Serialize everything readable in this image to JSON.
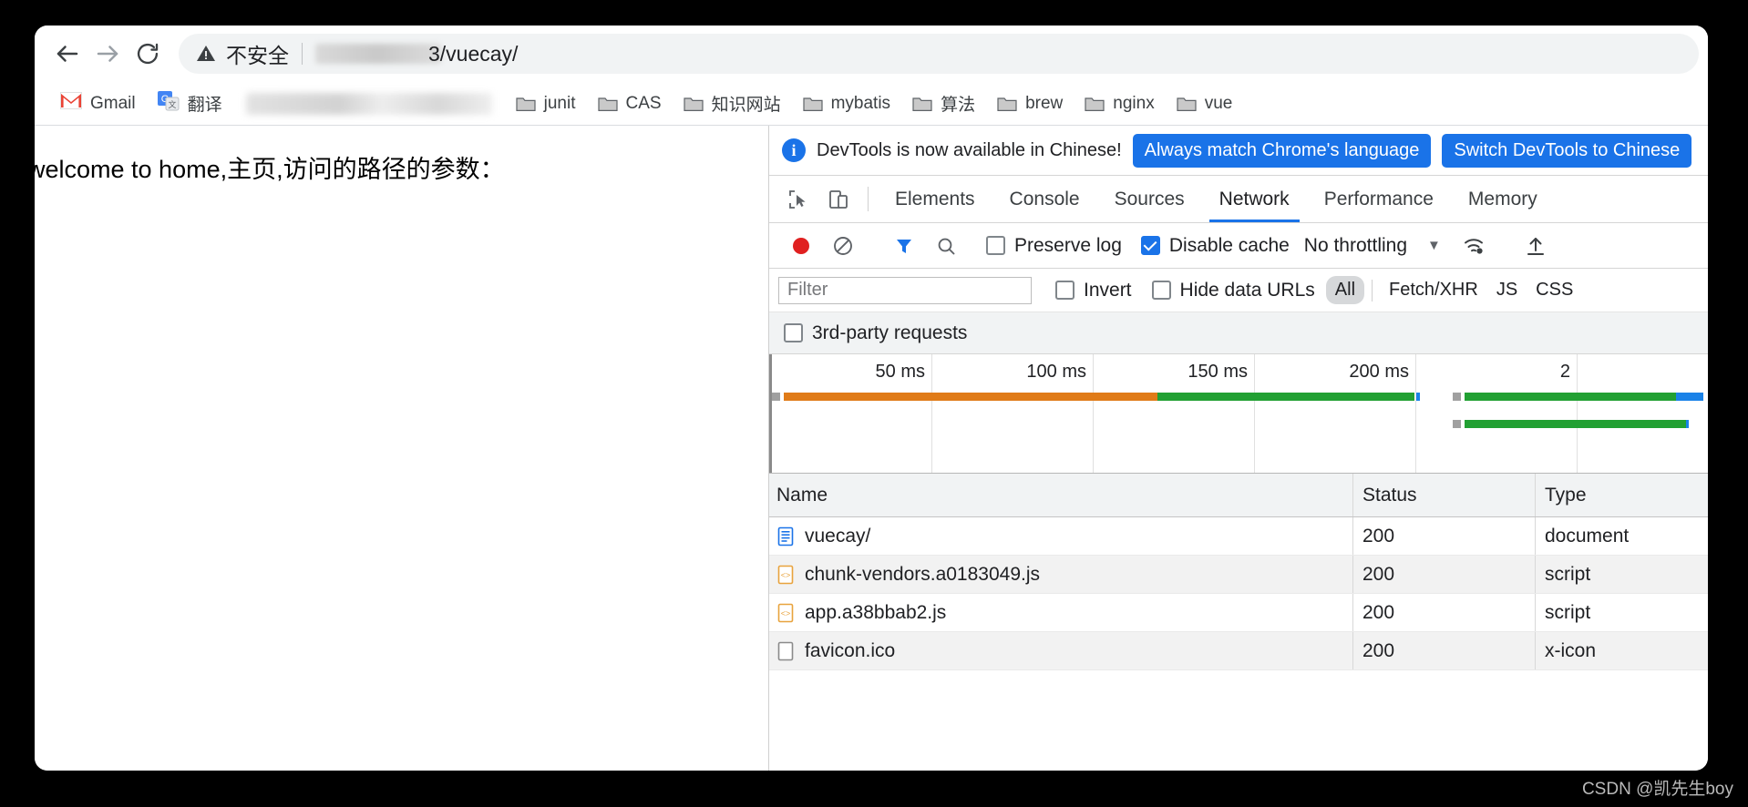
{
  "browser": {
    "back_label": "back-arrow",
    "forward_label": "forward-arrow",
    "reload_label": "reload",
    "security_text": "不安全",
    "url_text": "3/vuecay/",
    "bookmarks": [
      {
        "label": "Gmail",
        "icon": "gmail-icon"
      },
      {
        "label": "翻译",
        "icon": "google-translate-icon"
      },
      {
        "label": "",
        "icon": "redacted"
      },
      {
        "label": "junit",
        "icon": "folder-icon"
      },
      {
        "label": "CAS",
        "icon": "folder-icon"
      },
      {
        "label": "知识网站",
        "icon": "folder-icon"
      },
      {
        "label": "mybatis",
        "icon": "folder-icon"
      },
      {
        "label": "算法",
        "icon": "folder-icon"
      },
      {
        "label": "brew",
        "icon": "folder-icon"
      },
      {
        "label": "nginx",
        "icon": "folder-icon"
      },
      {
        "label": "vue",
        "icon": "folder-icon"
      }
    ]
  },
  "page": {
    "content_text": "welcome to home,主页,访问的路径的参数："
  },
  "devtools": {
    "banner": {
      "message": "DevTools is now available in Chinese!",
      "primary_button": "Always match Chrome's language",
      "secondary_button": "Switch DevTools to Chinese"
    },
    "tabs": [
      {
        "label": "Elements",
        "active": false
      },
      {
        "label": "Console",
        "active": false
      },
      {
        "label": "Sources",
        "active": false
      },
      {
        "label": "Network",
        "active": true
      },
      {
        "label": "Performance",
        "active": false
      },
      {
        "label": "Memory",
        "active": false
      }
    ],
    "toolbar": {
      "record_icon": "record-icon",
      "clear_icon": "clear-icon",
      "filter_icon": "filter-icon",
      "search_icon": "search-icon",
      "preserve_log_label": "Preserve log",
      "preserve_log_checked": false,
      "disable_cache_label": "Disable cache",
      "disable_cache_checked": true,
      "throttling_value": "No throttling",
      "throttling_caret": "▼",
      "wifi_icon": "network-conditions-icon",
      "import_icon": "import-har-icon"
    },
    "filterbar": {
      "filter_placeholder": "Filter",
      "invert_label": "Invert",
      "invert_checked": false,
      "hide_data_urls_label": "Hide data URLs",
      "hide_data_urls_checked": false,
      "types": [
        {
          "label": "All",
          "selected": true
        },
        {
          "label": "Fetch/XHR",
          "selected": false
        },
        {
          "label": "JS",
          "selected": false
        },
        {
          "label": "CSS",
          "selected": false
        }
      ],
      "third_party_label": "3rd-party requests",
      "third_party_checked": false
    },
    "overview": {
      "ticks": [
        "50 ms",
        "100 ms",
        "150 ms",
        "200 ms",
        "2"
      ],
      "colors": {
        "orange": "#e07b18",
        "green": "#22a033",
        "blue": "#1a82e8",
        "handle": "#a0a0a0"
      }
    },
    "requests": {
      "columns": [
        "Name",
        "Status",
        "Type"
      ],
      "rows": [
        {
          "name": "vuecay/",
          "status": "200",
          "type": "document",
          "icon": "document-icon"
        },
        {
          "name": "chunk-vendors.a0183049.js",
          "status": "200",
          "type": "script",
          "icon": "script-icon"
        },
        {
          "name": "app.a38bbab2.js",
          "status": "200",
          "type": "script",
          "icon": "script-icon"
        },
        {
          "name": "favicon.ico",
          "status": "200",
          "type": "x-icon",
          "icon": "generic-file-icon"
        }
      ]
    }
  },
  "watermark": {
    "text": "CSDN @凯先生boy"
  }
}
